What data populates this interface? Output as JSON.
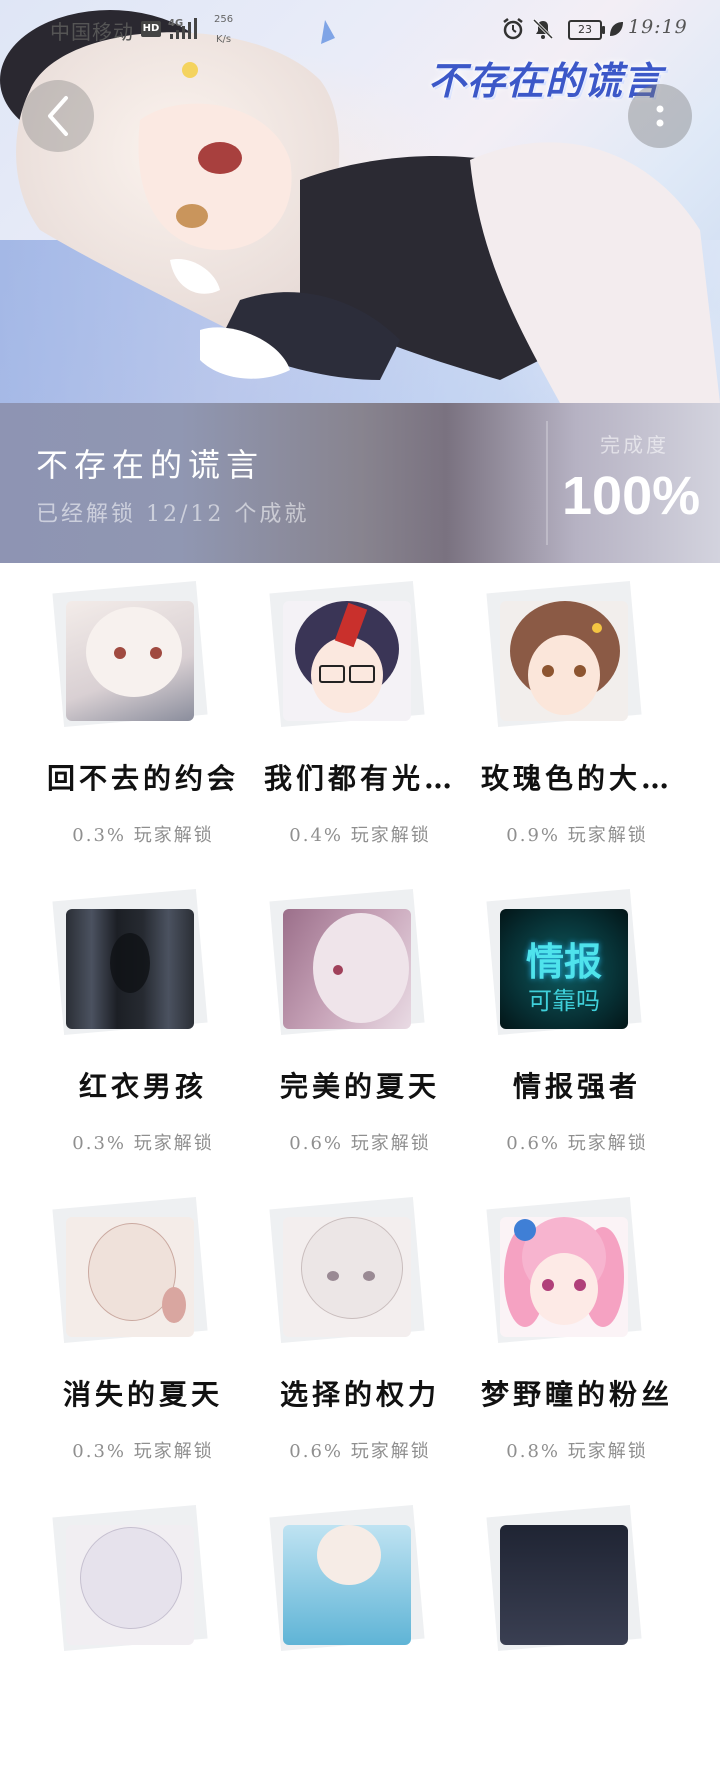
{
  "status_bar": {
    "carrier": "中国移动",
    "hd": "HD",
    "network": "4G",
    "speed_value": "256",
    "speed_unit": "K/s",
    "battery": "23",
    "time": "19:19"
  },
  "hero": {
    "logo_text": "不存在的谎言"
  },
  "info": {
    "title": "不存在的谎言",
    "subtitle": "已经解锁 12/12 个成就",
    "completion_label": "完成度",
    "completion_value": "100%"
  },
  "achievements": [
    {
      "title": "回不去的约会",
      "rate": "0.3% 玩家解锁"
    },
    {
      "title": "我们都有光…",
      "rate": "0.4% 玩家解锁"
    },
    {
      "title": "玫瑰色的大…",
      "rate": "0.9% 玩家解锁"
    },
    {
      "title": "红衣男孩",
      "rate": "0.3% 玩家解锁"
    },
    {
      "title": "完美的夏天",
      "rate": "0.6% 玩家解锁"
    },
    {
      "title": "情报强者",
      "rate": "0.6% 玩家解锁"
    },
    {
      "title": "消失的夏天",
      "rate": "0.3% 玩家解锁"
    },
    {
      "title": "选择的权力",
      "rate": "0.6% 玩家解锁"
    },
    {
      "title": "梦野瞳的粉丝",
      "rate": "0.8% 玩家解锁"
    }
  ],
  "intel_thumb": {
    "line1": "情报",
    "line2": "可靠吗"
  },
  "colors": {
    "title_text": "#111111",
    "rate_text": "#8f8f8f",
    "logo_blue": "#3c58c8"
  },
  "icons": [
    "back-arrow-icon",
    "more-vertical-icon",
    "alarm-icon",
    "mute-bell-icon",
    "battery-icon",
    "leaf-icon",
    "signal-icon"
  ]
}
